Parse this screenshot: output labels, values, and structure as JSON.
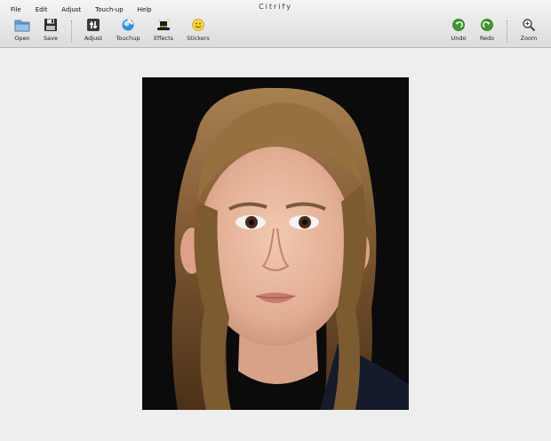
{
  "app": {
    "title": "Citrify"
  },
  "menu": {
    "items": [
      "File",
      "Edit",
      "Adjust",
      "Touch-up",
      "Help"
    ]
  },
  "toolbar": {
    "open": "Open",
    "save": "Save",
    "adjust": "Adjust",
    "touchup": "Touchup",
    "effects": "Effects",
    "stickers": "Stickers",
    "undo": "Undo",
    "redo": "Redo",
    "zoom": "Zoom"
  },
  "icons": {
    "open": "folder-icon",
    "save": "floppy-disk-icon",
    "adjust": "adjust-icon",
    "touchup": "touchup-icon",
    "effects": "magic-hat-icon",
    "stickers": "smiley-icon",
    "undo": "undo-arrow-icon",
    "redo": "redo-arrow-icon",
    "zoom": "magnifier-icon"
  },
  "colors": {
    "undo_redo": "#3a9a2a",
    "background": "#eeeeee",
    "photo_background": "#0b0b0b"
  }
}
